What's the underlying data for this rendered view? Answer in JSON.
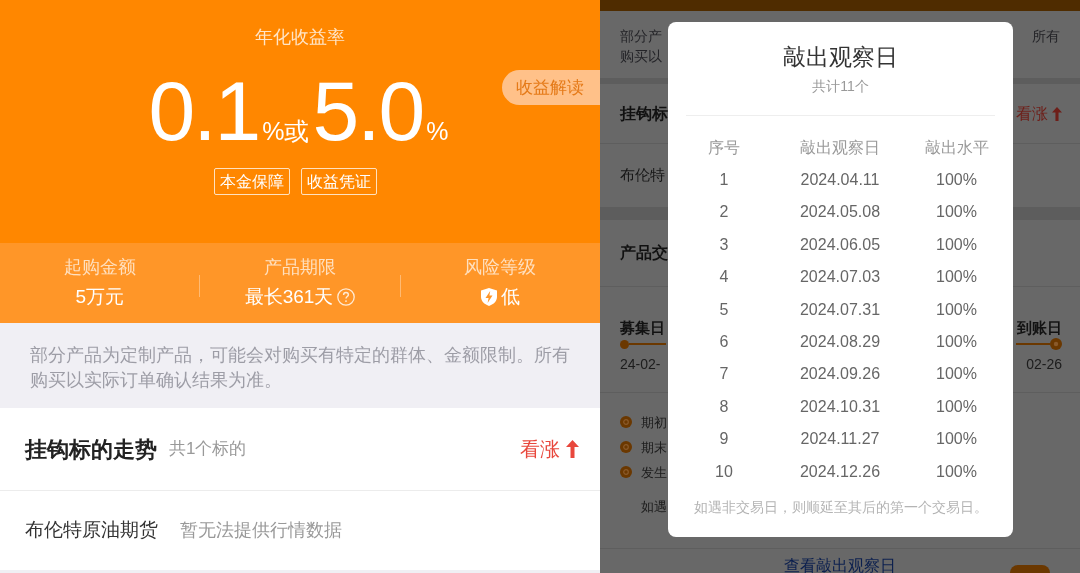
{
  "left_screen": {
    "hero": {
      "label": "年化收益率",
      "rate_min": "0.1",
      "joiner": "%或",
      "rate_max": "5.0",
      "unit": "%",
      "explain_button": "收益解读",
      "tags": [
        "本金保障",
        "收益凭证"
      ]
    },
    "stats": [
      {
        "kind": "plain",
        "label": "起购金额",
        "value": "5万元"
      },
      {
        "kind": "help",
        "label": "产品期限",
        "value": "最长361天"
      },
      {
        "kind": "risk",
        "label": "风险等级",
        "value": "低"
      }
    ],
    "notice": "部分产品为定制产品，可能会对购买有特定的群体、金额限制。所有购买以实际订单确认结果为准。",
    "underlying": {
      "title": "挂钩标的走势",
      "count": "共1个标的",
      "outlook": "看涨",
      "items": [
        {
          "name": "布伦特原油期货",
          "status": "暂无法提供行情数据"
        }
      ]
    }
  },
  "right_screen": {
    "background_page": {
      "notice_lines": [
        "部分产",
        "购买以"
      ],
      "notice_tail": "所有",
      "section_title": "挂钩标",
      "outlook": "看涨",
      "item_name": "布伦特",
      "section_2_title": "产品交",
      "timeline": {
        "start_label": "募集日",
        "start_date": "24-02-",
        "end_label": "到账日",
        "end_date": "02-26"
      },
      "legend": [
        "期初",
        "期末",
        "发生"
      ],
      "note": "如遇",
      "link": "查看敲出观察日"
    },
    "dialog": {
      "title": "敲出观察日",
      "subtitle": "共计11个",
      "columns": [
        "序号",
        "敲出观察日",
        "敲出水平"
      ],
      "rows": [
        [
          "1",
          "2024.04.11",
          "100%"
        ],
        [
          "2",
          "2024.05.08",
          "100%"
        ],
        [
          "3",
          "2024.06.05",
          "100%"
        ],
        [
          "4",
          "2024.07.03",
          "100%"
        ],
        [
          "5",
          "2024.07.31",
          "100%"
        ],
        [
          "6",
          "2024.08.29",
          "100%"
        ],
        [
          "7",
          "2024.09.26",
          "100%"
        ],
        [
          "8",
          "2024.10.31",
          "100%"
        ],
        [
          "9",
          "2024.11.27",
          "100%"
        ],
        [
          "10",
          "2024.12.26",
          "100%"
        ]
      ],
      "footnote": "如遇非交易日，则顺延至其后的第一个交易日。"
    }
  }
}
